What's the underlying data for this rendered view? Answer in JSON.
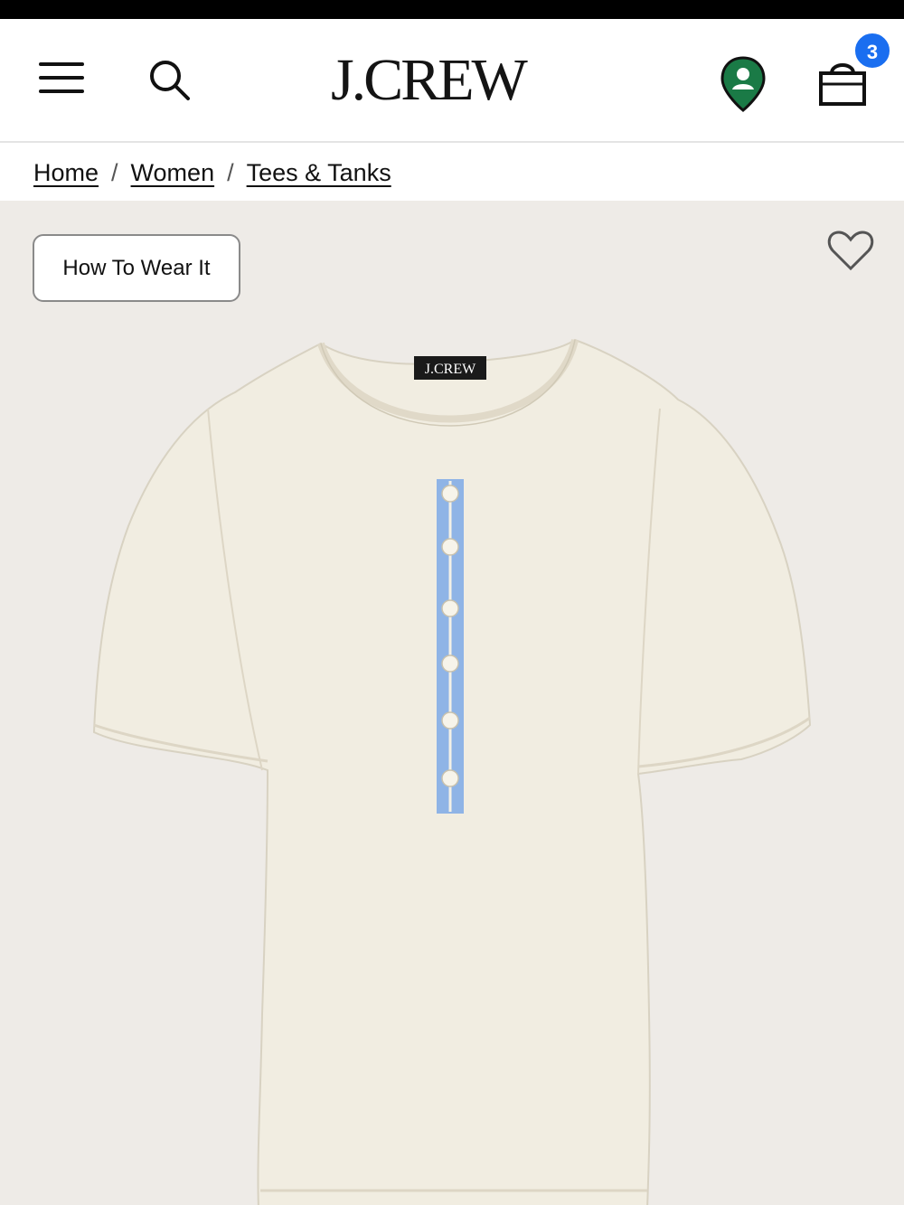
{
  "header": {
    "logo": "J.CREW",
    "bag_count": "3",
    "icons": [
      "menu-icon",
      "search-icon",
      "location-pin-icon",
      "shopping-bag-icon"
    ]
  },
  "breadcrumb": {
    "items": [
      "Home",
      "Women",
      "Tees & Tanks"
    ],
    "separator": "/"
  },
  "product": {
    "how_to_wear_label": "How To Wear It",
    "image_label": "J.CREW",
    "icons": [
      "heart-icon"
    ]
  },
  "colors": {
    "background_product": "#eeebe7",
    "badge": "#1a6ef0",
    "location_pin": "#1a7a46",
    "shirt": "#f1ede1",
    "placket": "#8fb4e6"
  }
}
